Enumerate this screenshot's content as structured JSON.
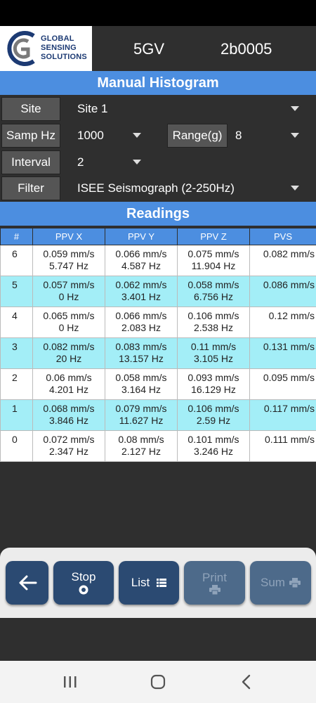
{
  "header": {
    "logo_lines": [
      "GLOBAL",
      "SENSING",
      "SOLUTIONS"
    ],
    "device_code": "5GV",
    "device_id": "2b0005"
  },
  "title": "Manual Histogram",
  "form": {
    "site": {
      "label": "Site",
      "value": "Site 1"
    },
    "samp_hz": {
      "label": "Samp Hz",
      "value": "1000"
    },
    "range": {
      "label": "Range(g)",
      "value": "8"
    },
    "interval": {
      "label": "Interval",
      "value": "2"
    },
    "filter": {
      "label": "Filter",
      "value": "ISEE Seismograph (2-250Hz)"
    }
  },
  "readings_title": "Readings",
  "table": {
    "headers": [
      "#",
      "PPV X",
      "PPV Y",
      "PPV Z",
      "PVS"
    ],
    "rows": [
      {
        "idx": "6",
        "x_ppv": "0.059 mm/s",
        "x_hz": "5.747 Hz",
        "y_ppv": "0.066 mm/s",
        "y_hz": "4.587 Hz",
        "z_ppv": "0.075 mm/s",
        "z_hz": "11.904 Hz",
        "pvs": "0.082 mm/s"
      },
      {
        "idx": "5",
        "x_ppv": "0.057 mm/s",
        "x_hz": "0 Hz",
        "y_ppv": "0.062 mm/s",
        "y_hz": "3.401 Hz",
        "z_ppv": "0.058 mm/s",
        "z_hz": "6.756 Hz",
        "pvs": "0.086 mm/s"
      },
      {
        "idx": "4",
        "x_ppv": "0.065 mm/s",
        "x_hz": "0 Hz",
        "y_ppv": "0.066 mm/s",
        "y_hz": "2.083 Hz",
        "z_ppv": "0.106 mm/s",
        "z_hz": "2.538 Hz",
        "pvs": "0.12 mm/s"
      },
      {
        "idx": "3",
        "x_ppv": "0.082 mm/s",
        "x_hz": "20 Hz",
        "y_ppv": "0.083 mm/s",
        "y_hz": "13.157 Hz",
        "z_ppv": "0.11 mm/s",
        "z_hz": "3.105 Hz",
        "pvs": "0.131 mm/s"
      },
      {
        "idx": "2",
        "x_ppv": "0.06 mm/s",
        "x_hz": "4.201 Hz",
        "y_ppv": "0.058 mm/s",
        "y_hz": "3.164 Hz",
        "z_ppv": "0.093 mm/s",
        "z_hz": "16.129 Hz",
        "pvs": "0.095 mm/s"
      },
      {
        "idx": "1",
        "x_ppv": "0.068 mm/s",
        "x_hz": "3.846 Hz",
        "y_ppv": "0.079 mm/s",
        "y_hz": "11.627 Hz",
        "z_ppv": "0.106 mm/s",
        "z_hz": "2.59 Hz",
        "pvs": "0.117 mm/s"
      },
      {
        "idx": "0",
        "x_ppv": "0.072 mm/s",
        "x_hz": "2.347 Hz",
        "y_ppv": "0.08 mm/s",
        "y_hz": "2.127 Hz",
        "z_ppv": "0.101 mm/s",
        "z_hz": "3.246 Hz",
        "pvs": "0.111 mm/s"
      }
    ]
  },
  "toolbar": {
    "back_icon": "arrow-left-icon",
    "stop_label": "Stop",
    "list_label": "List",
    "print_label": "Print",
    "sum_label": "Sum"
  },
  "colors": {
    "accent": "#4c8ee0",
    "row_highlight": "#a3eef7",
    "button": "#2b4a72"
  }
}
